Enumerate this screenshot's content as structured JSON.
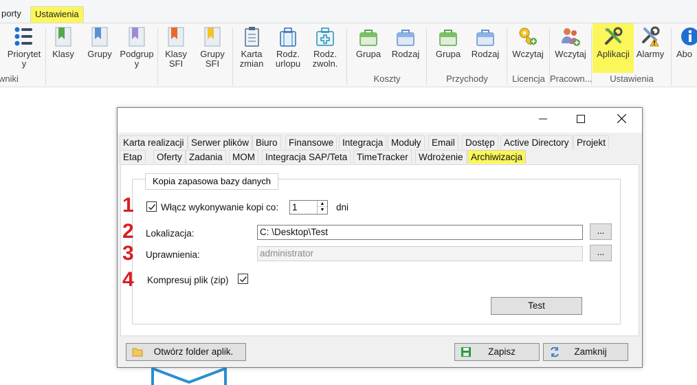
{
  "ribbon": {
    "tabs": [
      "porty",
      "Ustawienia"
    ],
    "buttons": [
      {
        "label": "Priorytet\ny",
        "icon": "priority-list-icon"
      },
      {
        "label": "Klasy",
        "icon": "bookmark-green-icon"
      },
      {
        "label": "Grupy",
        "icon": "bookmark-blue-icon"
      },
      {
        "label": "Podgrup\ny",
        "icon": "bookmark-purple-icon"
      },
      {
        "label": "Klasy\nSFI",
        "icon": "bookmark-orange-icon"
      },
      {
        "label": "Grupy\nSFI",
        "icon": "bookmark-yellow-icon"
      },
      {
        "label": "Karta\nzmian",
        "icon": "clipboard-icon"
      },
      {
        "label": "Rodz.\nurlopu",
        "icon": "suitcase-icon"
      },
      {
        "label": "Rodz.\nzwoln.",
        "icon": "medical-kit-icon"
      },
      {
        "label": "Grupa",
        "icon": "bag-green-icon"
      },
      {
        "label": "Rodzaj",
        "icon": "bag-blue-icon"
      },
      {
        "label": "Grupa",
        "icon": "bag-green-icon"
      },
      {
        "label": "Rodzaj",
        "icon": "bag-blue-icon"
      },
      {
        "label": "Wczytaj",
        "icon": "key-icon"
      },
      {
        "label": "Wczytaj",
        "icon": "users-add-icon"
      },
      {
        "label": "Aplikacji",
        "icon": "tools-icon"
      },
      {
        "label": "Alarmy",
        "icon": "tools-warning-icon"
      },
      {
        "label": "Abo",
        "icon": "info-icon"
      }
    ],
    "groups": [
      "wniki",
      "Koszty",
      "Przychody",
      "Licencja",
      "Pracown...",
      "Ustawienia"
    ]
  },
  "dialog": {
    "window_controls": [
      "minimize",
      "maximize",
      "close"
    ],
    "tabs_row1": [
      "Karta realizacji",
      "Serwer plików",
      "Biuro",
      "Finansowe",
      "Integracja",
      "Moduły",
      "Email",
      "Dostęp",
      "Active Directory",
      "Projekt"
    ],
    "tabs_row2": [
      "Etap",
      "Oferty",
      "Zadania",
      "MOM",
      "Integracja SAP/Teta",
      "TimeTracker",
      "Wdrożenie",
      "Archiwizacja"
    ],
    "group_title": "Kopia zapasowa bazy danych",
    "markers": [
      "1",
      "2",
      "3",
      "4"
    ],
    "enable_label": "Włącz wykonywanie kopi co:",
    "enable_checked": true,
    "interval_value": "1",
    "interval_unit": "dni",
    "location_label": "Lokalizacja:",
    "location_value": "C: \\Desktop\\Test",
    "permissions_label": "Uprawnienia:",
    "permissions_value": "administrator",
    "browse_label": "...",
    "compress_label": "Kompresuj plik (zip)",
    "compress_checked": true,
    "test_label": "Test",
    "open_folder_label": "Otwórz folder aplik.",
    "save_label": "Zapisz",
    "close_label": "Zamknij"
  },
  "colors": {
    "highlight": "#fbf75a",
    "marker_red": "#d71f26"
  }
}
